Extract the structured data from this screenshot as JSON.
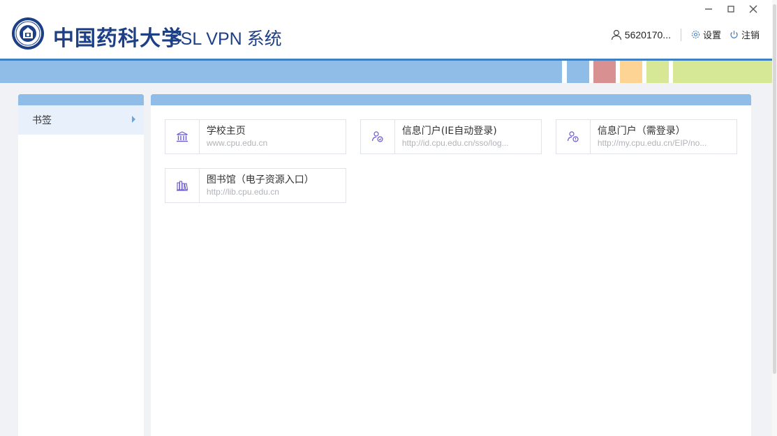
{
  "header": {
    "logo_text": "中国药科大学",
    "app_title": "SSL VPN 系统",
    "user_name": "5620170...",
    "settings_label": "设置",
    "logout_label": "注销"
  },
  "sidebar": {
    "items": [
      {
        "label": "书签"
      }
    ]
  },
  "bookmarks": [
    {
      "name": "学校主页",
      "url": "www.cpu.edu.cn",
      "icon": "building-icon"
    },
    {
      "name": "信息门户(IE自动登录)",
      "url": "http://id.cpu.edu.cn/sso/log...",
      "icon": "user-shield-icon"
    },
    {
      "name": "信息门户（需登录）",
      "url": "http://my.cpu.edu.cn/EIP/no...",
      "icon": "user-lock-icon"
    },
    {
      "name": "图书馆（电子资源入口）",
      "url": "http://lib.cpu.edu.cn",
      "icon": "books-icon"
    }
  ],
  "colors": {
    "brand_blue": "#1d3f86",
    "band_blue": "#8fbde8",
    "band_red": "#d99090",
    "band_orange": "#fdd494",
    "band_green": "#d6e796",
    "icon_purple": "#6a5acd"
  }
}
